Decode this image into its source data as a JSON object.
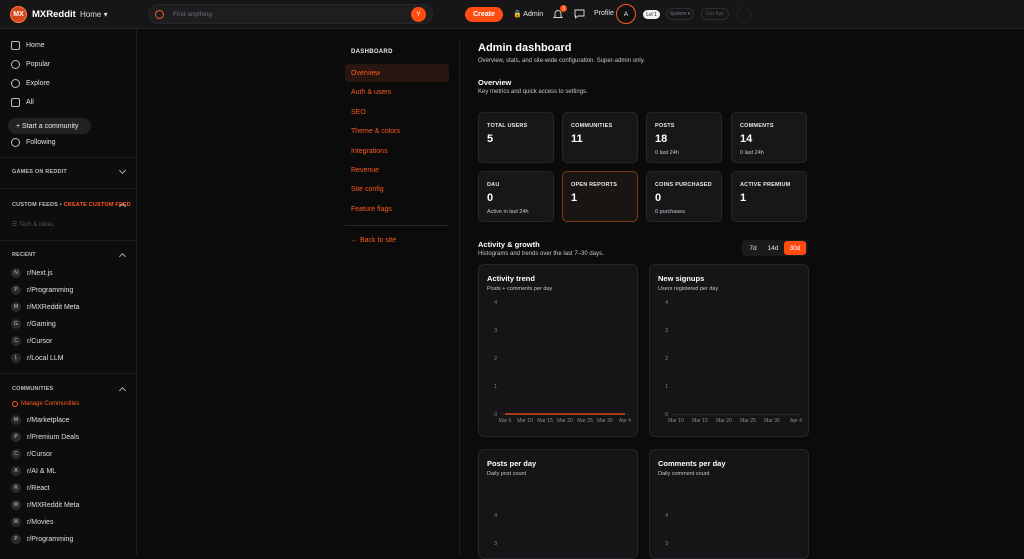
{
  "topbar": {
    "logo_text": "MX",
    "brand": "MXReddit",
    "home_label": "Home",
    "search_placeholder": "Find anything",
    "search_button": "Y",
    "create_label": "Create",
    "admin_label": "Admin",
    "notif_count": "3",
    "profile_label": "Profile",
    "avatar_letter": "A",
    "level_label": "Lvl 1",
    "system_label": "System ▾",
    "get_app_label": "Get App"
  },
  "sidebar": {
    "nav": [
      {
        "label": "Home",
        "icon": "home-icon"
      },
      {
        "label": "Popular",
        "icon": "popular-icon"
      },
      {
        "label": "Explore",
        "icon": "explore-icon"
      },
      {
        "label": "All",
        "icon": "all-icon"
      }
    ],
    "start_community": "+ Start a community",
    "following": "Following",
    "games_header": "GAMES ON REDDIT",
    "custom_feeds_header": "CUSTOM FEEDS •",
    "create_custom_feed": "CREATE CUSTOM FEED",
    "custom_feed_item": "Tech & Ideas",
    "recent_header": "RECENT",
    "recent": [
      {
        "avatar": "N",
        "name": "r/Next.js"
      },
      {
        "avatar": "P",
        "name": "r/Programming"
      },
      {
        "avatar": "M",
        "name": "r/MXReddit Meta"
      },
      {
        "avatar": "G",
        "name": "r/Gaming"
      },
      {
        "avatar": "C",
        "name": "r/Cursor"
      },
      {
        "avatar": "L",
        "name": "r/Local LLM"
      }
    ],
    "communities_header": "COMMUNITIES",
    "manage_communities": "Manage Communities",
    "communities": [
      {
        "avatar": "M",
        "name": "r/Marketplace"
      },
      {
        "avatar": "P",
        "name": "r/Premium Deals"
      },
      {
        "avatar": "C",
        "name": "r/Cursor"
      },
      {
        "avatar": "A",
        "name": "r/AI & ML"
      },
      {
        "avatar": "R",
        "name": "r/React"
      },
      {
        "avatar": "M",
        "name": "r/MXReddit Meta"
      },
      {
        "avatar": "M",
        "name": "r/Movies"
      },
      {
        "avatar": "P",
        "name": "r/Programming"
      }
    ]
  },
  "subnav": {
    "title": "DASHBOARD",
    "items": [
      "Overview",
      "Auth & users",
      "SEO",
      "Theme & colors",
      "Integrations",
      "Revenue",
      "Site config",
      "Feature flags"
    ],
    "back_label": "← Back to site"
  },
  "main": {
    "title": "Admin dashboard",
    "subtitle": "Overview, stats, and site-wide configuration. Super-admin only.",
    "overview_title": "Overview",
    "overview_sub": "Key metrics and quick access to settings.",
    "cards": [
      {
        "label": "TOTAL USERS",
        "value": "5",
        "meta": ""
      },
      {
        "label": "COMMUNITIES",
        "value": "11",
        "meta": ""
      },
      {
        "label": "POSTS",
        "value": "18",
        "meta": "0 last 24h"
      },
      {
        "label": "COMMENTS",
        "value": "14",
        "meta": "0 last 24h"
      },
      {
        "label": "DAU",
        "value": "0",
        "meta": "Active in last 24h"
      },
      {
        "label": "OPEN REPORTS",
        "value": "1",
        "meta": ""
      },
      {
        "label": "COINS PURCHASED",
        "value": "0",
        "meta": "0 purchases"
      },
      {
        "label": "ACTIVE PREMIUM",
        "value": "1",
        "meta": ""
      }
    ],
    "activity_title": "Activity & growth",
    "activity_sub": "Histograms and trends over the last 7–30 days.",
    "ranges": [
      "7d",
      "14d",
      "30d"
    ],
    "active_range": "30d",
    "panels": [
      {
        "title": "Activity trend",
        "subtitle": "Posts + comments per day"
      },
      {
        "title": "New signups",
        "subtitle": "Users registered per day"
      },
      {
        "title": "Posts per day",
        "subtitle": "Daily post count"
      },
      {
        "title": "Comments per day",
        "subtitle": "Daily comment count"
      }
    ]
  },
  "colors": {
    "accent": "#ff4d12",
    "bg": "#0b0b0c",
    "panel": "#151517"
  },
  "chart_data": [
    {
      "type": "line",
      "title": "Activity trend",
      "x": [
        "Mar 6",
        "Mar 10",
        "Mar 15",
        "Mar 20",
        "Mar 25",
        "Mar 30",
        "Apr 4"
      ],
      "yticks": [
        "0",
        "1",
        "2",
        "3",
        "4"
      ],
      "ylim": [
        0,
        4
      ],
      "series": [
        {
          "values": [
            0,
            0,
            0,
            0,
            0,
            0,
            0
          ],
          "color": "#ff4d12"
        }
      ]
    },
    {
      "type": "bar",
      "title": "New signups",
      "x": [
        "Mar 10",
        "Mar 15",
        "Mar 20",
        "Mar 25",
        "Mar 30",
        "Apr 4"
      ],
      "yticks": [
        "0",
        "1",
        "2",
        "3",
        "4"
      ],
      "ylim": [
        0,
        4
      ],
      "values": [
        0,
        0,
        0,
        0,
        0,
        0
      ]
    },
    {
      "type": "bar",
      "title": "Posts per day",
      "yticks": [
        "4",
        "3"
      ],
      "ylim": [
        0,
        4
      ]
    },
    {
      "type": "bar",
      "title": "Comments per day",
      "yticks": [
        "4",
        "3"
      ],
      "ylim": [
        0,
        4
      ]
    }
  ]
}
